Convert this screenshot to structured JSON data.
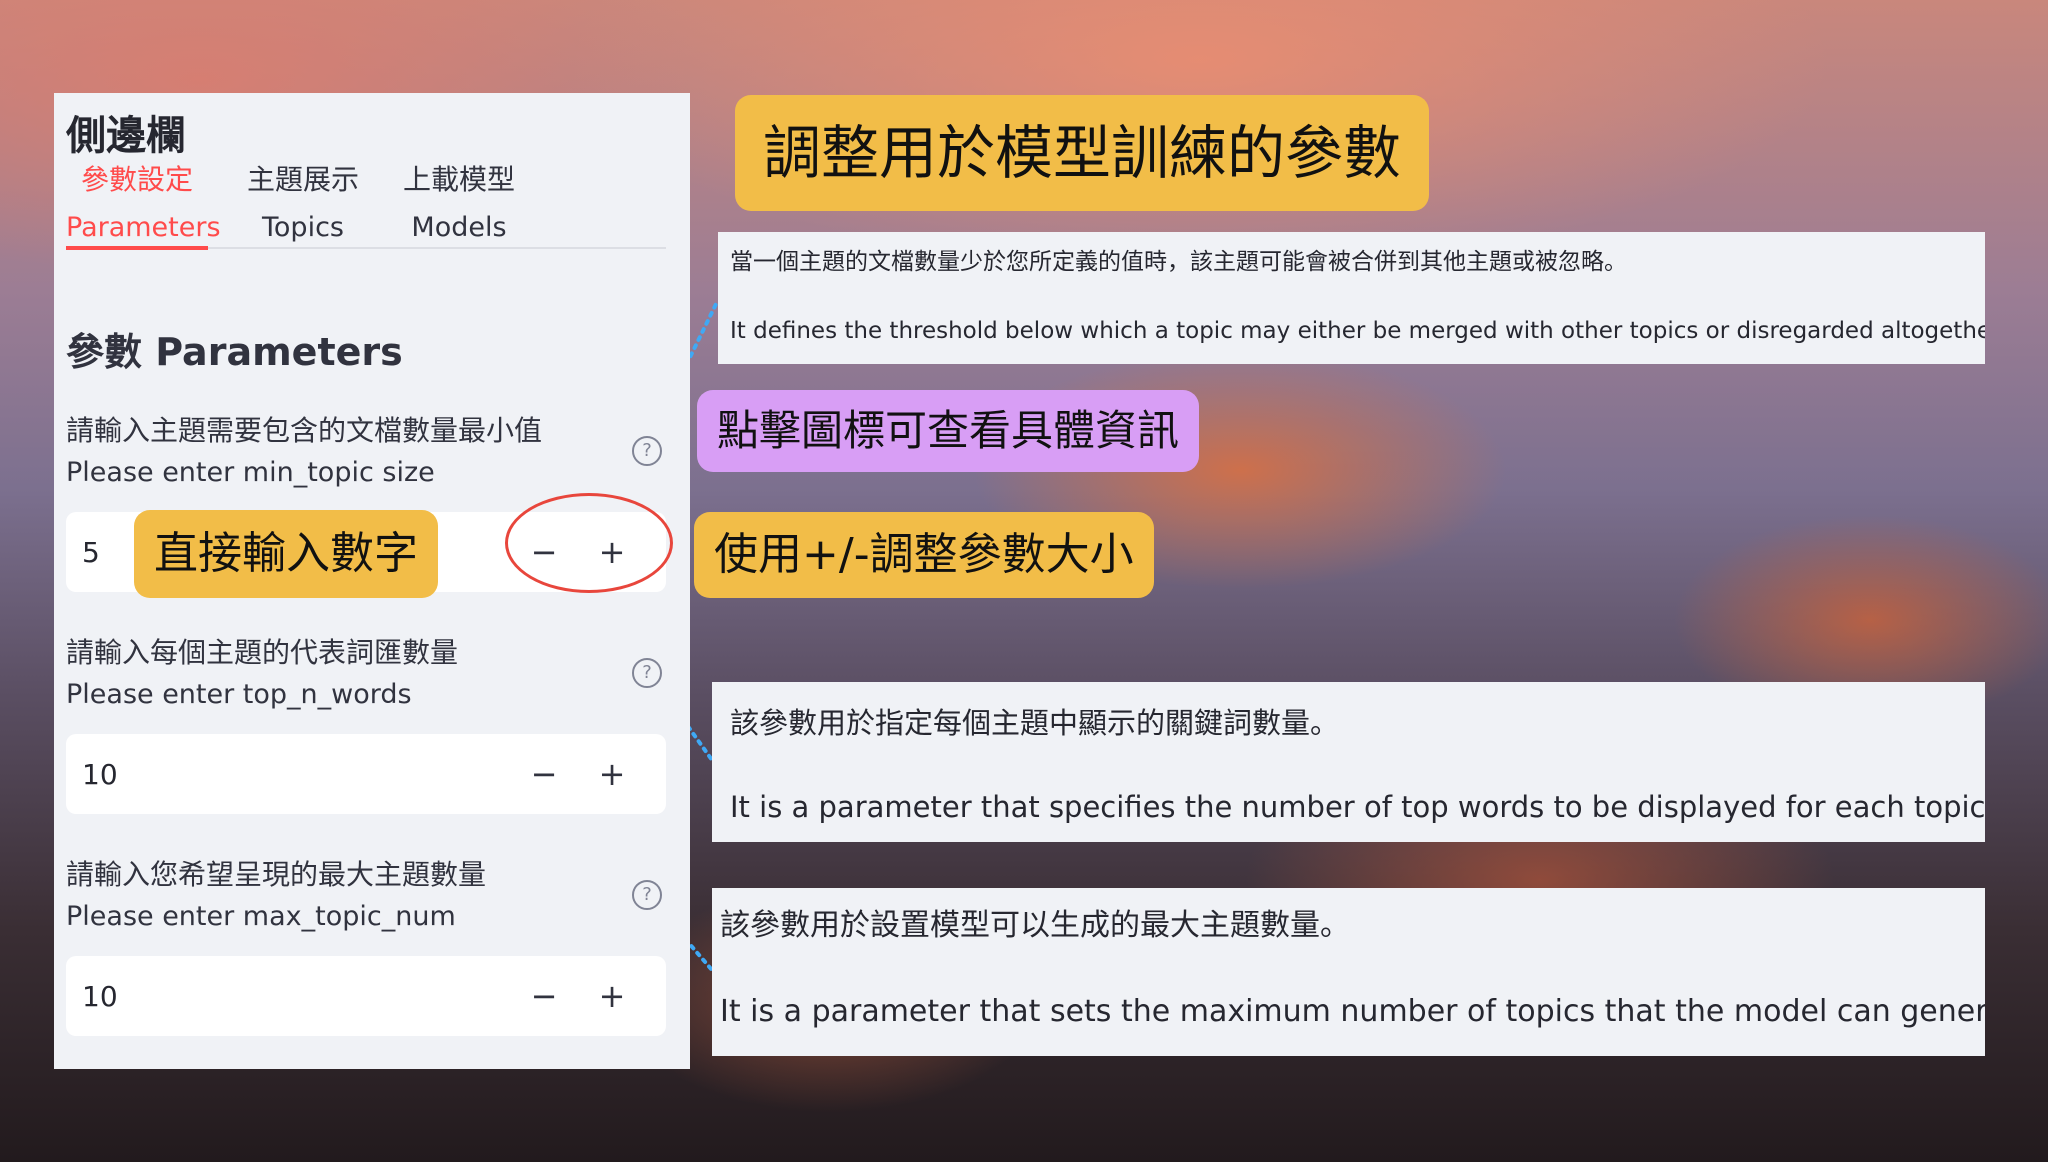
{
  "sidebar": {
    "title": "側邊欄",
    "tabs": [
      {
        "label_zh": "參數設定",
        "label_en": "Parameters",
        "active": true
      },
      {
        "label_zh": "主題展示",
        "label_en": "Topics",
        "active": false
      },
      {
        "label_zh": "上載模型",
        "label_en": "Models",
        "active": false
      }
    ],
    "section_heading": "參數 Parameters",
    "params": [
      {
        "label_zh": "請輸入主題需要包含的文檔數量最小值",
        "label_en": "Please enter min_topic size",
        "value": "5",
        "minus": "−",
        "plus": "+",
        "help": "?"
      },
      {
        "label_zh": "請輸入每個主題的代表詞匯數量",
        "label_en": "Please enter top_n_words",
        "value": "10",
        "minus": "−",
        "plus": "+",
        "help": "?"
      },
      {
        "label_zh": "請輸入您希望呈現的最大主題數量",
        "label_en": "Please enter max_topic_num",
        "value": "10",
        "minus": "−",
        "plus": "+",
        "help": "?"
      }
    ]
  },
  "callouts": {
    "adjust_params": "調整用於模型訓練的參數",
    "click_icon": "點擊圖標可查看具體資訊",
    "plus_minus": "使用+/-調整參數大小",
    "direct_input": "直接輸入數字"
  },
  "tooltips": [
    {
      "zh": "當一個主題的文檔數量少於您所定義的值時，該主題可能會被合併到其他主題或被忽略。",
      "en": "It defines the threshold below which a topic may either be merged with other topics or disregarded altogether."
    },
    {
      "zh": "該參數用於指定每個主題中顯示的關鍵詞數量。",
      "en": "It is a parameter that specifies the number of top words to be displayed for each topic."
    },
    {
      "zh": "該參數用於設置模型可以生成的最大主題數量。",
      "en": "It is a parameter that sets the maximum number of topics that the model can generate."
    }
  ],
  "colors": {
    "accent": "#ff4b4b",
    "callout_yellow": "#f2bd48",
    "callout_purple": "#d89ef5",
    "annotation_circle": "#e8463c",
    "leader_line": "#3fa9f5"
  }
}
